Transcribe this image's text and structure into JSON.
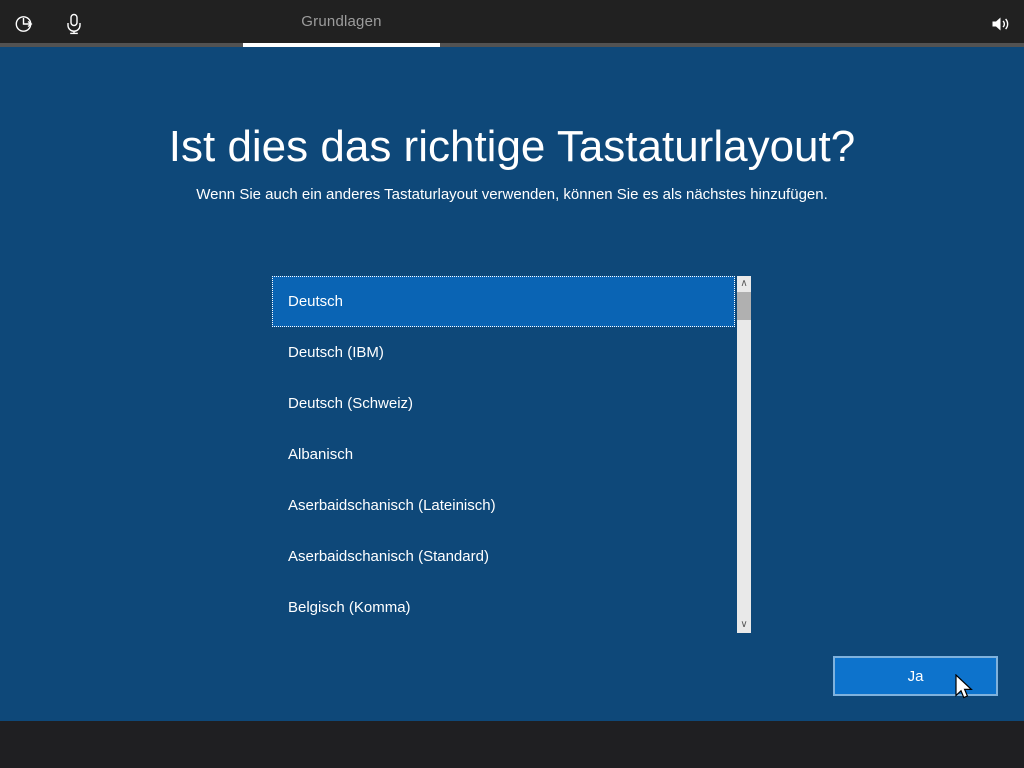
{
  "window": {
    "tab_label": "Grundlagen"
  },
  "heading": {
    "title": "Ist dies das richtige Tastaturlayout?",
    "subtitle": "Wenn Sie auch ein anderes Tastaturlayout verwenden, können Sie es als nächstes hinzufügen."
  },
  "keyboard_list": {
    "selected_index": 0,
    "items": [
      "Deutsch",
      "Deutsch (IBM)",
      "Deutsch (Schweiz)",
      "Albanisch",
      "Aserbaidschanisch (Lateinisch)",
      "Aserbaidschanisch (Standard)",
      "Belgisch (Komma)"
    ]
  },
  "scrollbar": {
    "up_glyph": "∧",
    "down_glyph": "∨"
  },
  "actions": {
    "confirm_label": "Ja"
  },
  "footer": {
    "icons": [
      "ease-of-access",
      "microphone",
      "volume"
    ]
  },
  "colors": {
    "page_background": "#0e4879",
    "topbar_background": "#212121",
    "tab_text": "#9c9c9c",
    "tab_underline": "#ffffff",
    "selected_item_background": "#0a64b4",
    "confirm_button_background": "#0d73cc",
    "confirm_button_border": "#7fb2dd",
    "scrollbar_track": "#e9e9e9",
    "scrollbar_thumb": "#b0b0b0",
    "bottombar_background": "#1f1f22"
  }
}
